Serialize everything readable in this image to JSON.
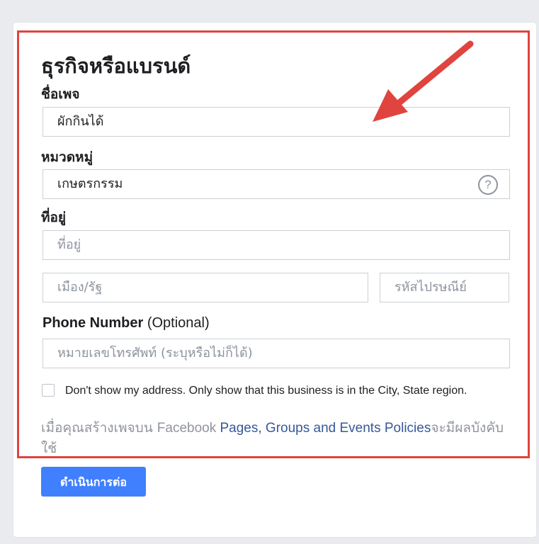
{
  "form": {
    "title": "ธุรกิจหรือแบรนด์",
    "page_name_label": "ชื่อเพจ",
    "page_name_value": "ผักกินได้",
    "category_label": "หมวดหมู่",
    "category_value": "เกษตรกรรม",
    "help_glyph": "?",
    "address_label": "ที่อยู่",
    "address_placeholder": "ที่อยู่",
    "city_placeholder": "เมือง/รัฐ",
    "zip_placeholder": "รหัสไปรษณีย์",
    "phone_label": "Phone Number",
    "phone_optional": "(Optional)",
    "phone_placeholder": "หมายเลขโทรศัพท์ (ระบุหรือไม่ก็ได้)",
    "hide_address_text": "Don't show my address. Only show that this business is in the City, State region.",
    "policy_prefix": "เมื่อคุณสร้างเพจบน ",
    "policy_brand": "Facebook ",
    "policy_link": "Pages, Groups and Events Policies",
    "policy_suffix": "จะมีผลบังคับใช้",
    "continue_label": "ดำเนินการต่อ"
  },
  "colors": {
    "highlight": "#e0443e",
    "button": "#4080ff",
    "link": "#365899"
  }
}
